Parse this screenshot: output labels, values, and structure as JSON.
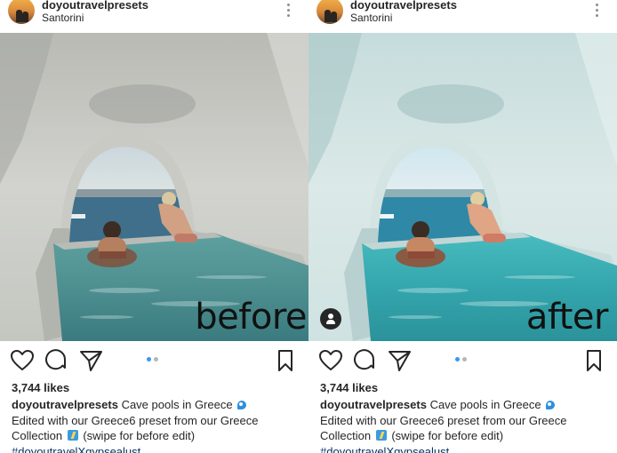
{
  "posts": [
    {
      "username": "doyoutravelpresets",
      "location": "Santorini",
      "overlay_text": "before",
      "likes": "3,744 likes",
      "caption": {
        "username": "doyoutravelpresets",
        "text1": "Cave pools in Greece",
        "text2": "Edited with our Greece6 preset from our Greece",
        "text3": "Collection",
        "text4": "(swipe for before edit)",
        "hashtag": "#doyoutravelXgypsealust"
      }
    },
    {
      "username": "doyoutravelpresets",
      "location": "Santorini",
      "overlay_text": "after",
      "likes": "3,744 likes",
      "caption": {
        "username": "doyoutravelpresets",
        "text1": "Cave pools in Greece",
        "text2": "Edited with our Greece6 preset from our Greece",
        "text3": "Collection",
        "text4": "(swipe for before edit)",
        "hashtag": "#doyoutravelXgypsealust"
      }
    }
  ],
  "icons": {
    "like": "heart-icon",
    "comment": "comment-icon",
    "share": "paper-plane-icon",
    "save": "bookmark-icon",
    "more": "more-vertical-icon",
    "tag": "user-tag-icon"
  },
  "carousel": {
    "current_slide": 1,
    "total_slides": 2
  },
  "colors": {
    "text": "#262626",
    "carousel_active": "#3897f0",
    "carousel_inactive": "#b6b6b6",
    "hashtag": "#003569"
  }
}
